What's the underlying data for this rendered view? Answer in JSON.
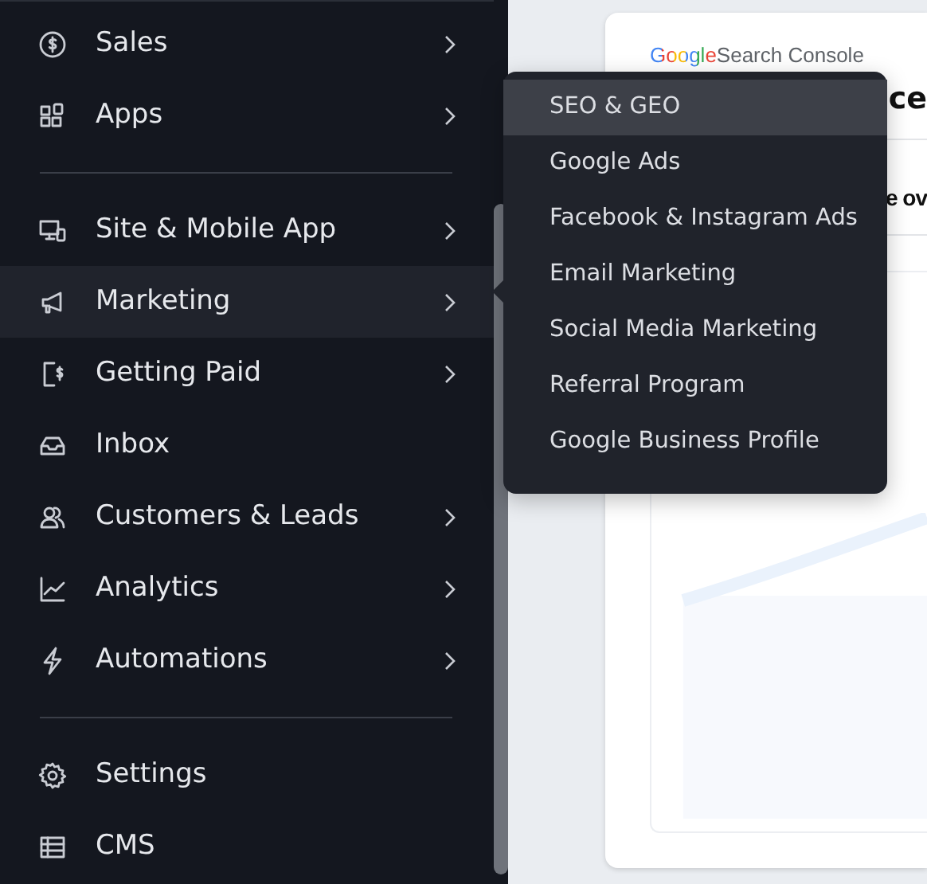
{
  "sidebar": {
    "groups": [
      [
        {
          "label": "Sales",
          "has_submenu": true,
          "selected": false
        },
        {
          "label": "Apps",
          "has_submenu": true,
          "selected": false
        }
      ],
      [
        {
          "label": "Site & Mobile App",
          "has_submenu": true,
          "selected": false
        },
        {
          "label": "Marketing",
          "has_submenu": true,
          "selected": true
        },
        {
          "label": "Getting Paid",
          "has_submenu": true,
          "selected": false
        },
        {
          "label": "Inbox",
          "has_submenu": false,
          "selected": false
        },
        {
          "label": "Customers & Leads",
          "has_submenu": true,
          "selected": false
        },
        {
          "label": "Analytics",
          "has_submenu": true,
          "selected": false
        },
        {
          "label": "Automations",
          "has_submenu": true,
          "selected": false
        }
      ],
      [
        {
          "label": "Settings",
          "has_submenu": false,
          "selected": false
        },
        {
          "label": "CMS",
          "has_submenu": false,
          "selected": false
        }
      ]
    ]
  },
  "submenu": {
    "items": [
      {
        "label": "SEO & GEO",
        "selected": true
      },
      {
        "label": "Google Ads",
        "selected": false
      },
      {
        "label": "Facebook & Instagram Ads",
        "selected": false
      },
      {
        "label": "Email Marketing",
        "selected": false
      },
      {
        "label": "Social Media Marketing",
        "selected": false
      },
      {
        "label": "Referral Program",
        "selected": false
      },
      {
        "label": "Google Business Profile",
        "selected": false
      }
    ]
  },
  "card": {
    "logo_brand": "Google",
    "logo_product": "Search Console",
    "heading": "ce",
    "subheading": "e ov"
  }
}
